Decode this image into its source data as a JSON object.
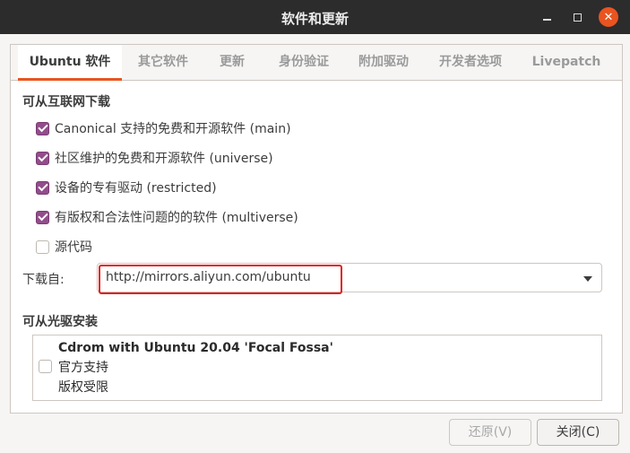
{
  "window": {
    "title": "软件和更新"
  },
  "tabs": [
    {
      "label": "Ubuntu 软件"
    },
    {
      "label": "其它软件"
    },
    {
      "label": "更新"
    },
    {
      "label": "身份验证"
    },
    {
      "label": "附加驱动"
    },
    {
      "label": "开发者选项"
    },
    {
      "label": "Livepatch"
    }
  ],
  "internet": {
    "title": "可从互联网下载",
    "options": [
      {
        "label": "Canonical 支持的免费和开源软件 (main)",
        "checked": true
      },
      {
        "label": "社区维护的免费和开源软件 (universe)",
        "checked": true
      },
      {
        "label": "设备的专有驱动 (restricted)",
        "checked": true
      },
      {
        "label": "有版权和合法性问题的的软件 (multiverse)",
        "checked": true
      },
      {
        "label": "源代码",
        "checked": false
      }
    ],
    "download_from_label": "下载自:",
    "download_from_value": "http://mirrors.aliyun.com/ubuntu"
  },
  "cdrom": {
    "title": "可从光驱安装",
    "item": {
      "name": "Cdrom with Ubuntu 20.04 'Focal Fossa'",
      "line2": "官方支持",
      "line3": "版权受限",
      "checked": false
    }
  },
  "buttons": {
    "revert": "还原(V)",
    "close": "关闭(C)"
  },
  "colors": {
    "accent": "#e95420",
    "checkbox": "#924d8b",
    "highlight": "#e02020"
  }
}
